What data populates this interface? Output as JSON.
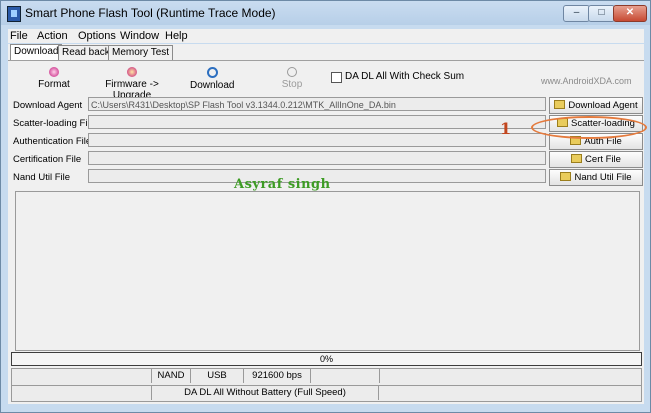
{
  "window": {
    "title": "Smart Phone Flash Tool (Runtime Trace Mode)",
    "controls": {
      "minimize": "–",
      "maximize": "□",
      "close": "✕"
    }
  },
  "menu": [
    "File",
    "Action",
    "Options",
    "Window",
    "Help"
  ],
  "tabs": [
    "Download",
    "Read back",
    "Memory Test"
  ],
  "toolbar": {
    "format": "Format",
    "firmware_upgrade": "Firmware -> Upgrade",
    "download": "Download",
    "stop": "Stop",
    "checksum_label": "DA DL All With Check Sum",
    "watermark": "www.AndroidXDA.com"
  },
  "files": [
    {
      "label": "Download Agent",
      "value": "C:\\Users\\R431\\Desktop\\SP Flash Tool v3.1344.0.212\\MTK_AllInOne_DA.bin",
      "button": "Download Agent"
    },
    {
      "label": "Scatter-loading File",
      "value": "",
      "button": "Scatter-loading"
    },
    {
      "label": "Authentication File",
      "value": "",
      "button": "Auth File"
    },
    {
      "label": "Certification File",
      "value": "",
      "button": "Cert File"
    },
    {
      "label": "Nand Util File",
      "value": "",
      "button": "Nand Util File"
    }
  ],
  "annotation": {
    "number": "1",
    "overlay_text": "Asyraf singh"
  },
  "progress": {
    "text": "0%",
    "value": 0
  },
  "status": {
    "storage": "NAND",
    "port": "USB",
    "baud": "921600 bps",
    "mode": "DA DL All Without Battery (Full Speed)"
  },
  "colors": {
    "accent_annotation": "#e47a3d",
    "overlay_text": "#3d9c24"
  }
}
